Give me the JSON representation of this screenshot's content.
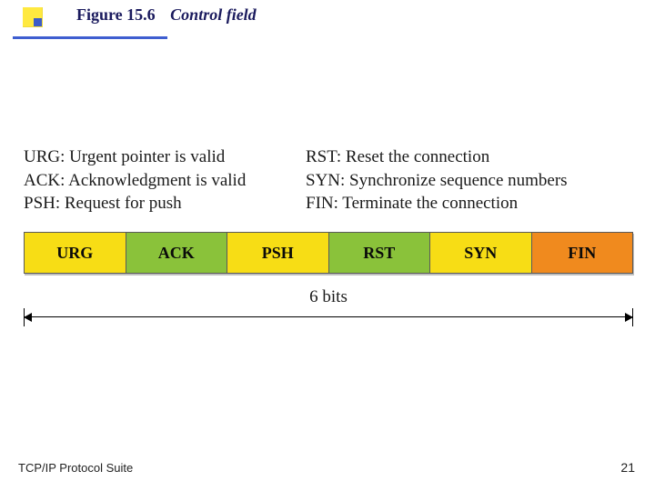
{
  "header": {
    "figure_number": "Figure 15.6",
    "caption": "Control field"
  },
  "definitions": {
    "left": [
      "URG: Urgent pointer is valid",
      "ACK: Acknowledgment is valid",
      "PSH: Request for push"
    ],
    "right": [
      "RST: Reset the connection",
      "SYN: Synchronize sequence numbers",
      "FIN: Terminate the connection"
    ]
  },
  "flags": [
    {
      "name": "URG",
      "color": "c-yellow"
    },
    {
      "name": "ACK",
      "color": "c-green"
    },
    {
      "name": "PSH",
      "color": "c-yellow"
    },
    {
      "name": "RST",
      "color": "c-green"
    },
    {
      "name": "SYN",
      "color": "c-yellow"
    },
    {
      "name": "FIN",
      "color": "c-orange"
    }
  ],
  "dimension_label": "6 bits",
  "footer": {
    "source": "TCP/IP Protocol Suite",
    "page": "21"
  },
  "chart_data": {
    "type": "table",
    "title": "TCP Control field flags (6 bits)",
    "flags": [
      "URG",
      "ACK",
      "PSH",
      "RST",
      "SYN",
      "FIN"
    ],
    "descriptions": {
      "URG": "Urgent pointer is valid",
      "ACK": "Acknowledgment is valid",
      "PSH": "Request for push",
      "RST": "Reset the connection",
      "SYN": "Synchronize sequence numbers",
      "FIN": "Terminate the connection"
    },
    "total_bits": 6
  }
}
